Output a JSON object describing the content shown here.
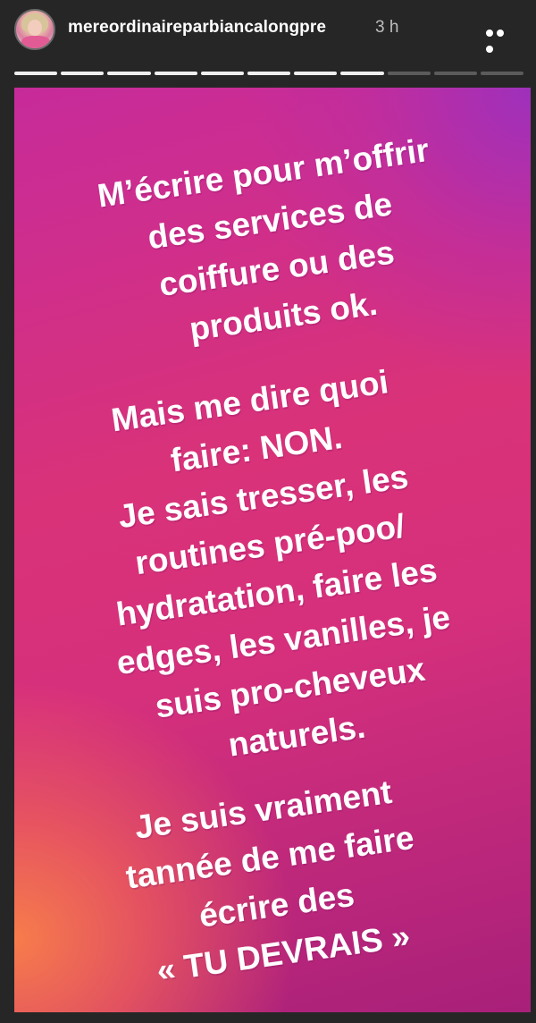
{
  "header": {
    "username": "mereordinaireparbiancalongpre",
    "time": "3 h",
    "more_icon": "more-horizontal-icon"
  },
  "progress": {
    "total_segments": 11,
    "current_segment": 8
  },
  "story": {
    "paragraph1": [
      "M’écrire pour m’offrir",
      "des services de",
      "coiffure ou des",
      "produits ok."
    ],
    "paragraph2": [
      "Mais me dire quoi",
      "faire: NON.",
      "Je sais tresser, les",
      "routines pré-poo/",
      "hydratation, faire les",
      "edges, les vanilles, je",
      "suis pro-cheveux",
      "naturels."
    ],
    "paragraph3": [
      "Je suis vraiment",
      "tannée de me faire",
      "écrire des",
      "« TU DEVRAIS »"
    ]
  },
  "colors": {
    "background": "#262626",
    "gradient_pink": "#d6307c",
    "gradient_purple": "#9c30be",
    "gradient_orange": "#f87e4a"
  }
}
